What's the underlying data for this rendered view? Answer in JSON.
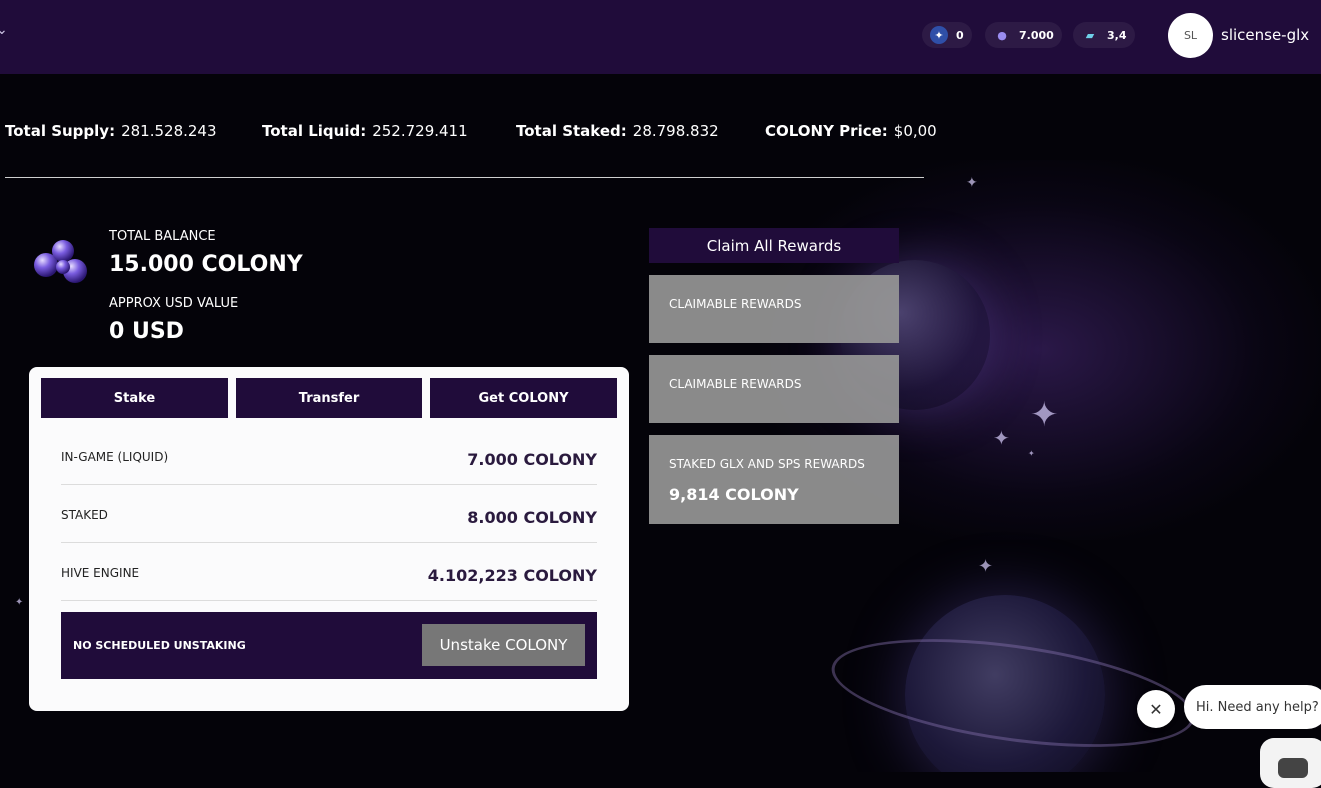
{
  "header": {
    "nav_chevron": "chevron-down-icon",
    "currencies": [
      {
        "icon": "star-compass-icon",
        "value": "0"
      },
      {
        "icon": "colony-crystal-icon",
        "value": "7.000"
      },
      {
        "icon": "energy-capsule-icon",
        "value": "3,4"
      }
    ],
    "avatar_initials": "SL",
    "username": "slicense-glx"
  },
  "stats": {
    "supply_label": "Total Supply:",
    "supply_value": "281.528.243",
    "liquid_label": "Total Liquid:",
    "liquid_value": "252.729.411",
    "staked_label": "Total Staked:",
    "staked_value": "28.798.832",
    "price_label": "COLONY Price:",
    "price_value": "$0,00"
  },
  "balance": {
    "total_label": "TOTAL BALANCE",
    "total_value": "15.000 COLONY",
    "usd_label": "APPROX USD VALUE",
    "usd_value": "0 USD"
  },
  "actions": {
    "stake": "Stake",
    "transfer": "Transfer",
    "get_colony": "Get COLONY"
  },
  "holdings": [
    {
      "label": "IN-GAME (LIQUID)",
      "value": "7.000 COLONY"
    },
    {
      "label": "STAKED",
      "value": "8.000 COLONY"
    },
    {
      "label": "HIVE ENGINE",
      "value": "4.102,223 COLONY"
    }
  ],
  "unstaking": {
    "status": "NO SCHEDULED UNSTAKING",
    "button": "Unstake COLONY"
  },
  "rewards": {
    "claim_all": "Claim All Rewards",
    "cards": [
      {
        "title": "CLAIMABLE REWARDS",
        "value": ""
      },
      {
        "title": "CLAIMABLE REWARDS",
        "value": ""
      },
      {
        "title": "STAKED GLX AND SPS REWARDS",
        "value": "9,814 COLONY"
      }
    ]
  },
  "chat": {
    "bubble": "Hi. Need any help?"
  },
  "colors": {
    "brand_purple": "#200c3a",
    "card_bg": "#fbfbfc",
    "reward_gray": "#969696"
  }
}
